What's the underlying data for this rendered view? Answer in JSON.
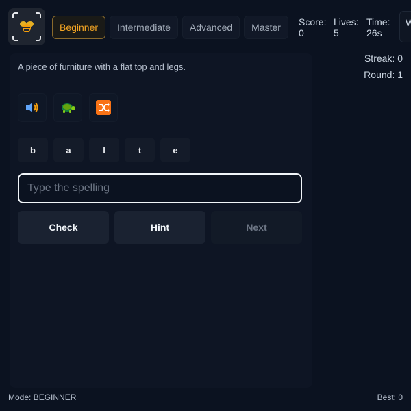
{
  "header": {
    "logo_icon": "bee-icon",
    "tabs": [
      {
        "label": "Beginner",
        "active": true
      },
      {
        "label": "Intermediate",
        "active": false
      },
      {
        "label": "Advanced",
        "active": false
      },
      {
        "label": "Master",
        "active": false
      }
    ],
    "stats": {
      "score_label": "Score:",
      "score_value": "0",
      "lives_label": "Lives:",
      "lives_value": "5",
      "time_label": "Time:",
      "time_value": "26s",
      "extra_label": "W"
    },
    "streak": "Streak: 0",
    "round": "Round: 1"
  },
  "main": {
    "prompt": "A piece of furniture with a flat top and legs.",
    "tools": [
      "speaker-icon",
      "turtle-icon",
      "shuffle-icon"
    ],
    "letters": [
      "b",
      "a",
      "l",
      "t",
      "e"
    ],
    "input": {
      "value": "",
      "placeholder": "Type the spelling"
    },
    "buttons": {
      "check": "Check",
      "hint": "Hint",
      "next": "Next"
    }
  },
  "footer": {
    "mode": "Mode: BEGINNER",
    "best": "Best: 0"
  },
  "colors": {
    "accent": "#f5a623",
    "background": "#0b1220",
    "card": "#0e1524"
  }
}
